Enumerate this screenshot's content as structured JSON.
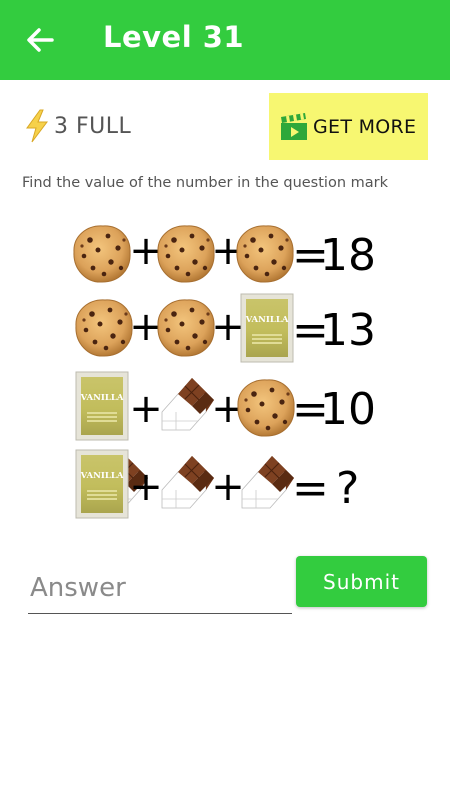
{
  "header": {
    "title": "Level 31",
    "back_icon": "arrow-back-icon",
    "background_color": "#33cc3f"
  },
  "energy": {
    "icon": "lightning-bolt-icon",
    "text": "3 FULL"
  },
  "get_more": {
    "icon": "video-clapper-icon",
    "label": "GET MORE",
    "background_color": "#f7f771"
  },
  "question": "Find the value of the number in the question mark",
  "puzzle": {
    "rows": [
      {
        "items": [
          "cookie",
          "cookie",
          "cookie"
        ],
        "operators": [
          "+",
          "+"
        ],
        "equals": "=",
        "result": "18"
      },
      {
        "items": [
          "cookie",
          "cookie",
          "vanilla"
        ],
        "operators": [
          "+",
          "+"
        ],
        "equals": "=",
        "result": "13"
      },
      {
        "items": [
          "vanilla",
          "chocolate",
          "cookie"
        ],
        "operators": [
          "+",
          "+"
        ],
        "equals": "=",
        "result": "10"
      },
      {
        "items": [
          "vanilla",
          "chocolate",
          "chocolate"
        ],
        "operators": [
          "+",
          "+"
        ],
        "equals": "=",
        "result": " ?"
      }
    ],
    "vanilla_label": "VANILLA"
  },
  "answer": {
    "placeholder": "Answer",
    "value": ""
  },
  "submit": {
    "label": "Submit",
    "background_color": "#33cc3f"
  }
}
